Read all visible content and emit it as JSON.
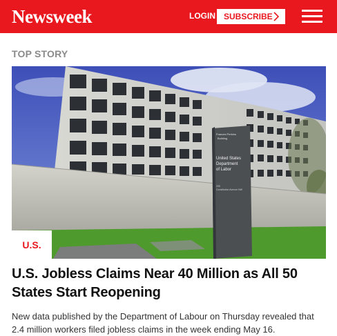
{
  "header": {
    "logo": "Newsweek",
    "login_label": "LOGIN",
    "subscribe_label": "SUBSCRIBE",
    "brand_color": "#e9181f",
    "icons": [
      "chevron-right-icon",
      "hamburger-menu-icon"
    ]
  },
  "section": {
    "label": "TOP STORY"
  },
  "story": {
    "category": "U.S.",
    "headline": "U.S. Jobless Claims Near 40 Million as All 50 States Start Reopening",
    "summary": "New data published by the Department of Labour on Thursday revealed that 2.4 million workers filed jobless claims in the week ending May 16.",
    "sign": {
      "top_text": [
        "Frances Perkins",
        "Building"
      ],
      "main_text": [
        "United States",
        "Department",
        "of Labor"
      ],
      "small_text": [
        "200",
        "Constitution Avenue NW"
      ]
    }
  }
}
